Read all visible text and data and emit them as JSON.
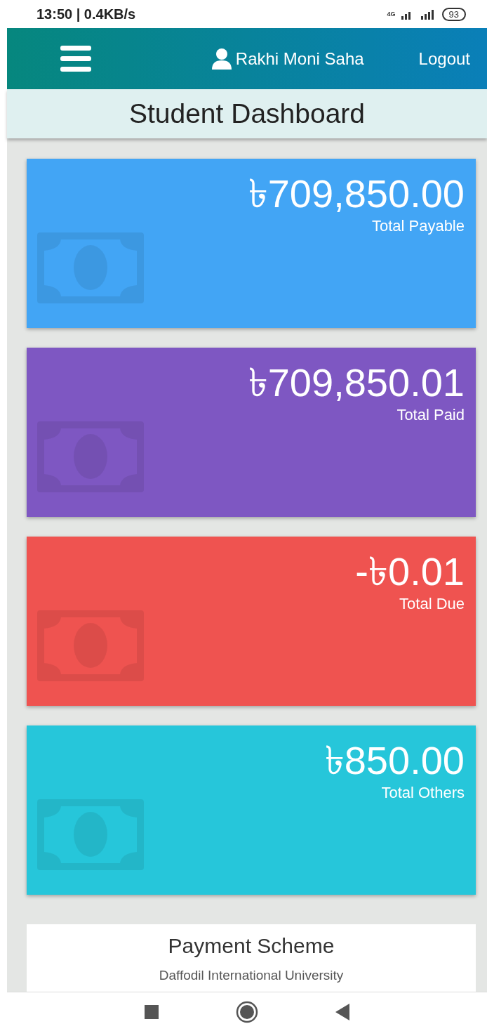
{
  "status_bar": {
    "time": "13:50",
    "speed": "| 0.4KB/s",
    "network": "4G",
    "battery": "93"
  },
  "header": {
    "user": "Rakhi Moni Saha",
    "logout": "Logout"
  },
  "title": "Student Dashboard",
  "cards": [
    {
      "amount": "৳709,850.00",
      "label": "Total Payable",
      "color": "#42a5f5"
    },
    {
      "amount": "৳709,850.01",
      "label": "Total Paid",
      "color": "#7e57c2"
    },
    {
      "amount": "-৳0.01",
      "label": "Total Due",
      "color": "#ef5350"
    },
    {
      "amount": "৳850.00",
      "label": "Total Others",
      "color": "#26c6da"
    }
  ],
  "payment_scheme": {
    "title": "Payment Scheme",
    "subtitle": "Daffodil International University"
  }
}
